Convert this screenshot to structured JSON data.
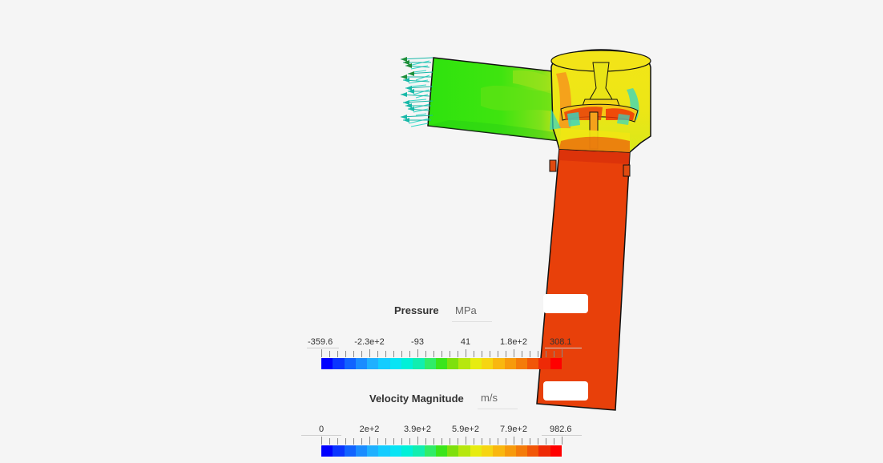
{
  "scene": {
    "name": "simulation-viewport",
    "colors": {
      "background": "#f5f5f5",
      "outline": "#111111",
      "high": "#e8400a",
      "mid_high": "#f5a21b",
      "mid": "#f1e513",
      "low_mid": "#7fe01a",
      "low": "#2fe40e",
      "cyan": "#33d6c6",
      "teal": "#1a9a8a"
    }
  },
  "legends": {
    "pressure": {
      "title": "Pressure",
      "unit": "MPa",
      "min_label": "-359.6",
      "max_label": "308.1",
      "ticks": [
        "-2.3e+2",
        "-93",
        "41",
        "1.8e+2"
      ]
    },
    "velocity": {
      "title": "Velocity Magnitude",
      "unit": "m/s",
      "min_label": "0",
      "max_label": "982.6",
      "ticks": [
        "2e+2",
        "3.9e+2",
        "5.9e+2",
        "7.9e+2"
      ]
    },
    "colormap": [
      "#0000ff",
      "#0a35ff",
      "#1163ff",
      "#1a8cff",
      "#1fb0ff",
      "#14ccff",
      "#08e4f4",
      "#00f0d8",
      "#11eeb0",
      "#30ec68",
      "#3be51b",
      "#7ee00d",
      "#b6e70f",
      "#e7ec10",
      "#f6d512",
      "#f9b70f",
      "#f79a0c",
      "#f47b0a",
      "#f15608",
      "#ee2a06",
      "#ff0000"
    ]
  }
}
